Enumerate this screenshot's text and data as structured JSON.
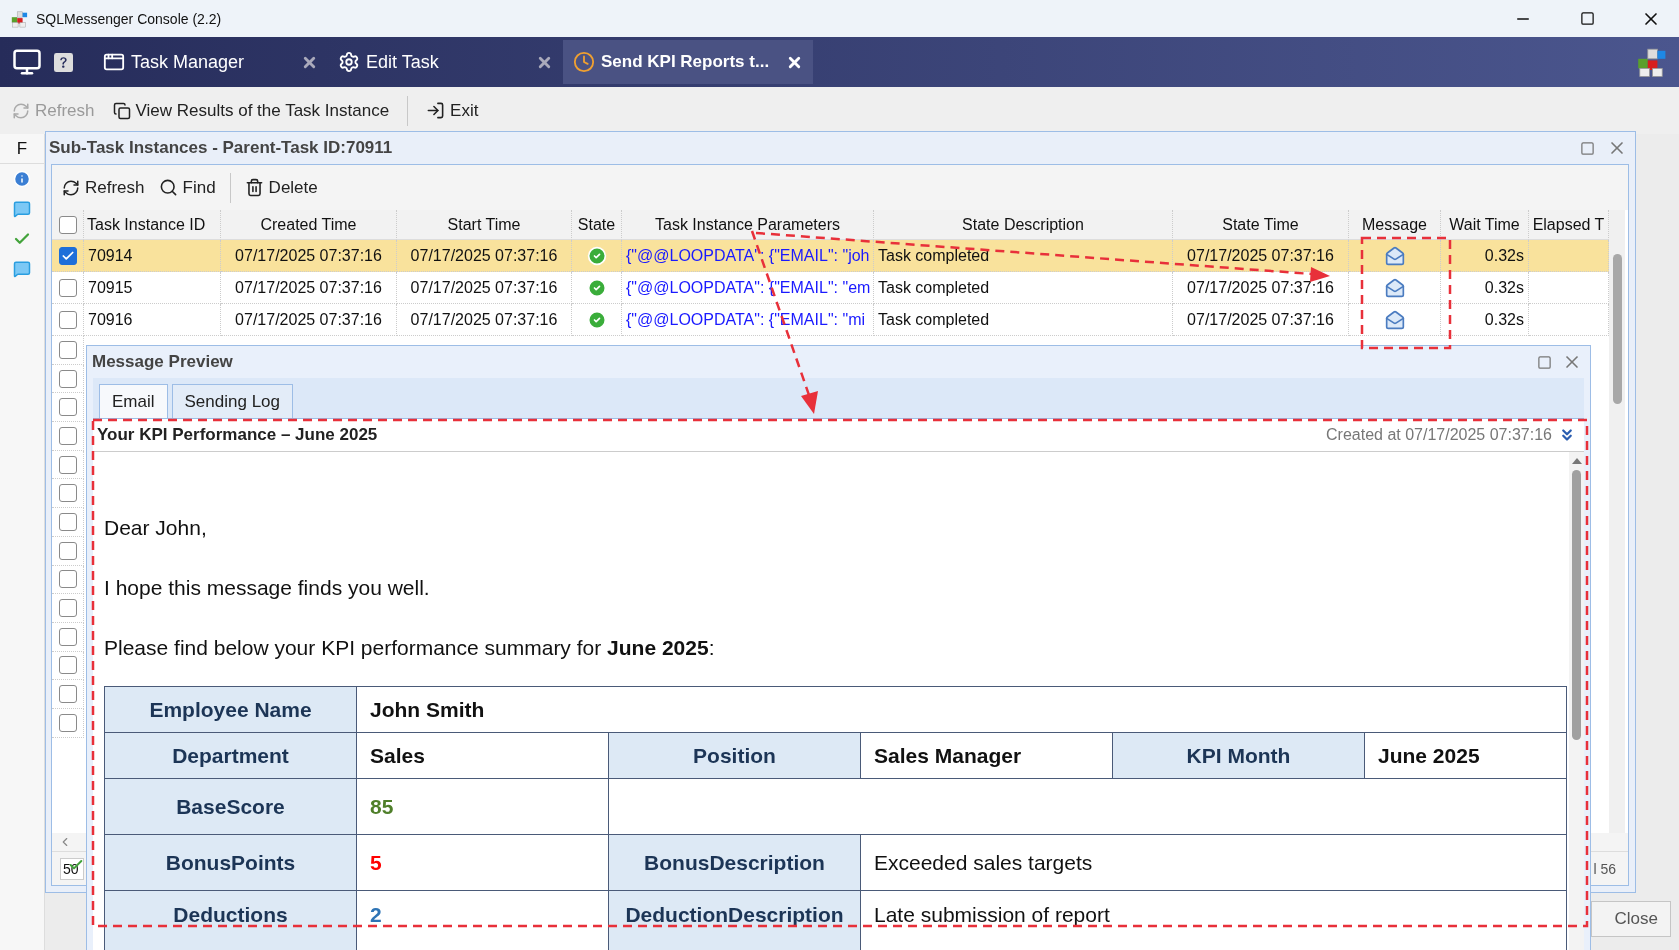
{
  "window": {
    "title": "SQLMessenger Console (2.2)"
  },
  "nav_tabs": [
    {
      "label": "Task Manager",
      "kind": "manager",
      "selected": false
    },
    {
      "label": "Edit Task",
      "kind": "settings",
      "selected": false
    },
    {
      "label": "Send KPI Reports t...",
      "kind": "task",
      "selected": true
    }
  ],
  "toolbar": [
    {
      "label": "Refresh",
      "kind": "refresh",
      "disabled": true
    },
    {
      "label": "View Results of the Task Instance",
      "kind": "copy",
      "disabled": false
    },
    {
      "label": "Exit",
      "kind": "exit",
      "disabled": false
    }
  ],
  "side_column": {
    "header": "F",
    "icons": [
      {
        "kind": "info"
      },
      {
        "kind": "message"
      },
      {
        "kind": "ok"
      },
      {
        "kind": "message"
      }
    ]
  },
  "subtask_window": {
    "title": "Sub-Task Instances - Parent-Task ID:70911",
    "toolbar": [
      {
        "label": "Refresh",
        "kind": "refresh"
      },
      {
        "label": "Find",
        "kind": "find"
      },
      {
        "label": "Delete",
        "kind": "delete"
      }
    ],
    "table": {
      "select_all": {
        "checked": false
      },
      "columns": [
        "Task Instance ID",
        "Created Time",
        "Start Time",
        "State",
        "Task Instance Parameters",
        "State Description",
        "State Time",
        "Message",
        "Wait Time",
        "Elapsed T"
      ],
      "rows": [
        {
          "checked": true,
          "selected": true,
          "id": "70914",
          "created": "07/17/2025 07:37:16",
          "start": "07/17/2025 07:37:16",
          "completed": true,
          "parameters": "{\"@@LOOPDATA\": {\"EMAIL\": \"joh",
          "description": "Task completed",
          "state_time": "07/17/2025 07:37:16",
          "wait": "0.32s"
        },
        {
          "checked": false,
          "selected": false,
          "id": "70915",
          "created": "07/17/2025 07:37:16",
          "start": "07/17/2025 07:37:16",
          "completed": true,
          "parameters": "{\"@@LOOPDATA\": {\"EMAIL\": \"em",
          "description": "Task completed",
          "state_time": "07/17/2025 07:37:16",
          "wait": "0.32s"
        },
        {
          "checked": false,
          "selected": false,
          "id": "70916",
          "created": "07/17/2025 07:37:16",
          "start": "07/17/2025 07:37:16",
          "completed": true,
          "parameters": "{\"@@LOOPDATA\": {\"EMAIL\": \"mi",
          "description": "Task completed",
          "state_time": "07/17/2025 07:37:16",
          "wait": "0.32s"
        }
      ],
      "covered_rows": [
        {
          "checked": false
        },
        {
          "checked": false
        },
        {
          "checked": false
        },
        {
          "checked": false
        },
        {
          "checked": false
        },
        {
          "checked": false
        },
        {
          "checked": false
        },
        {
          "checked": false
        },
        {
          "checked": false
        },
        {
          "checked": false
        },
        {
          "checked": false
        },
        {
          "checked": false
        },
        {
          "checked": false
        },
        {
          "checked": false
        }
      ]
    },
    "pager": {
      "page_size": "50",
      "status_text": "l 56"
    }
  },
  "preview": {
    "title": "Message Preview",
    "tabs": [
      {
        "label": "Email",
        "selected": true
      },
      {
        "label": "Sending Log",
        "selected": false
      }
    ],
    "subject": "Your KPI Performance – June 2025",
    "created_label": "Created at",
    "created_time": "07/17/2025 07:37:16",
    "paragraphs": [
      "Dear John,",
      "I hope this message finds you well.",
      "Please find below your KPI performance summary for **June 2025**:"
    ],
    "kpi_table": [
      [
        {
          "kind": "label",
          "text": "Employee Name"
        },
        {
          "kind": "value",
          "text": "John Smith"
        }
      ],
      [
        {
          "kind": "label",
          "text": "Department"
        },
        {
          "kind": "value",
          "text": "Sales"
        },
        {
          "kind": "label",
          "text": "Position"
        },
        {
          "kind": "value",
          "text": "Sales Manager"
        },
        {
          "kind": "label",
          "text": "KPI Month"
        },
        {
          "kind": "value",
          "text": "June 2025"
        }
      ],
      [
        {
          "kind": "label",
          "text": "BaseScore"
        },
        {
          "kind": "number",
          "text": "85",
          "color": "#4f7f2a"
        },
        {
          "kind": "empty"
        }
      ],
      [
        {
          "kind": "label",
          "text": "BonusPoints"
        },
        {
          "kind": "number",
          "text": "5",
          "color": "#ff0000"
        },
        {
          "kind": "label",
          "text": "BonusDescription"
        },
        {
          "kind": "text",
          "text": "Exceeded sales targets"
        }
      ],
      [
        {
          "kind": "label",
          "text": "Deductions"
        },
        {
          "kind": "number",
          "text": "2",
          "color": "#2e74b5"
        },
        {
          "kind": "label",
          "text": "DeductionDescription"
        },
        {
          "kind": "text",
          "text": "Late submission of report"
        }
      ]
    ]
  },
  "close_button": {
    "label": "Close"
  }
}
